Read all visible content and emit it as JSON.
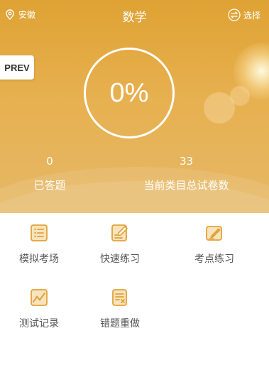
{
  "header": {
    "location": "安徽",
    "title": "数学",
    "select_label": "选择",
    "prev_label": "PREV",
    "progress_text": "0%",
    "progress_value": 0
  },
  "stats": {
    "answered_count": "0",
    "answered_label": "已答题",
    "total_count": "33",
    "total_label": "当前类目总试卷数"
  },
  "menu": {
    "items": [
      {
        "label": "模拟考场",
        "icon": "list-icon"
      },
      {
        "label": "快速练习",
        "icon": "edit-note-icon"
      },
      {
        "label": "考点练习",
        "icon": "pen-paper-icon"
      },
      {
        "label": "测试记录",
        "icon": "chart-icon"
      },
      {
        "label": "错题重做",
        "icon": "wrong-doc-icon"
      }
    ]
  },
  "colors": {
    "header_gradient_top": "#dfa233",
    "header_gradient_bottom": "#e5b866",
    "icon_accent": "#e2a239",
    "menu_text": "#555555"
  }
}
